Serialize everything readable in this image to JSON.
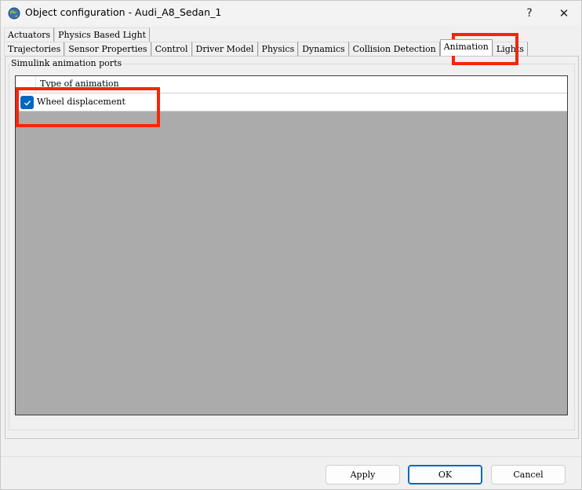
{
  "window": {
    "title": "Object configuration - Audi_A8_Sedan_1",
    "help_glyph": "?",
    "close_glyph": "✕",
    "icon": "globe-icon"
  },
  "tabs": {
    "row1": [
      {
        "label": "Actuators"
      },
      {
        "label": "Physics Based Light"
      }
    ],
    "row2": [
      {
        "label": "Trajectories"
      },
      {
        "label": "Sensor Properties"
      },
      {
        "label": "Control"
      },
      {
        "label": "Driver Model"
      },
      {
        "label": "Physics"
      },
      {
        "label": "Dynamics"
      },
      {
        "label": "Collision Detection"
      },
      {
        "label": "Animation",
        "active": true
      },
      {
        "label": "Lights"
      }
    ]
  },
  "panel": {
    "group_label": "Simulink animation ports",
    "list": {
      "header": "Type of animation",
      "rows": [
        {
          "label": "Wheel displacement",
          "checked": true
        }
      ]
    }
  },
  "buttons": {
    "apply": "Apply",
    "ok": "OK",
    "cancel": "Cancel"
  },
  "colors": {
    "highlight": "#f4260b",
    "accent": "#0067c0",
    "list_background": "#ababab"
  }
}
